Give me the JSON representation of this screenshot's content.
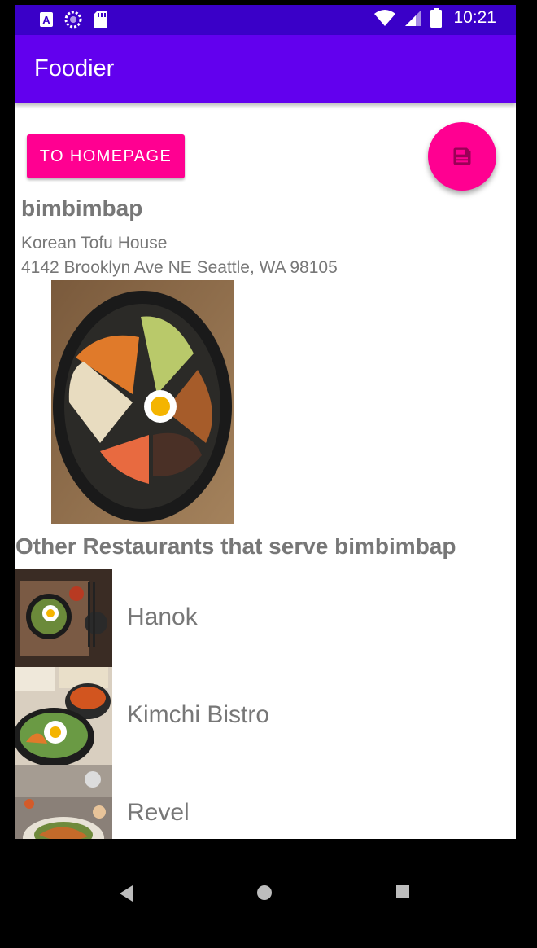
{
  "status_bar": {
    "time": "10:21",
    "icons": [
      "a-notification-icon",
      "sync-icon",
      "sd-card-icon",
      "wifi-icon",
      "signal-icon",
      "battery-icon"
    ]
  },
  "app_bar": {
    "title": "Foodier"
  },
  "actions": {
    "homepage_button": "TO HOMEPAGE",
    "fab_icon": "save-icon"
  },
  "dish": {
    "name": "bimbimbap",
    "restaurant": "Korean Tofu House",
    "address": "4142 Brooklyn Ave NE Seattle, WA 98105"
  },
  "others": {
    "title": "Other Restaurants that serve bimbimbap",
    "items": [
      {
        "name": "Hanok"
      },
      {
        "name": "Kimchi Bistro"
      },
      {
        "name": "Revel"
      }
    ]
  },
  "nav_bar": {
    "icons": [
      "back-icon",
      "home-icon",
      "recents-icon"
    ]
  },
  "colors": {
    "status_bar": "#3A00C8",
    "app_bar": "#6200EE",
    "accent": "#FF0091",
    "text_grey": "#777777"
  }
}
